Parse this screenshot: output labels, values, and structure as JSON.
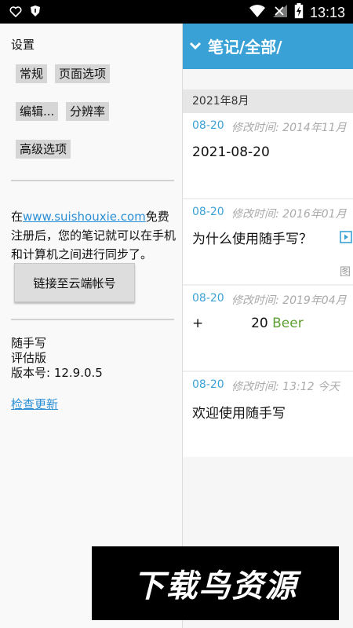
{
  "status_bar": {
    "time": "13:13"
  },
  "drawer": {
    "title": "设置",
    "chips": [
      "常规",
      "页面选项",
      "编辑...",
      "分辨率",
      "高级选项"
    ],
    "sync_prefix": "在",
    "sync_link": "www.suishouxie.com",
    "sync_suffix": "免费注册后，您的笔记就可以在手机和计算机之间进行同步了。",
    "cloud_button": "链接至云端帐号",
    "app_name": "随手写",
    "edition": "评估版",
    "version": "版本号: 12.9.0.5",
    "check_update": "检查更新"
  },
  "notes_panel": {
    "title": "笔记/全部/",
    "month": "2021年8月",
    "notes": [
      {
        "date": "08-20",
        "modified": "修改时间: 2014年11月",
        "body": "2021-08-20"
      },
      {
        "date": "08-20",
        "modified": "修改时间: 2016年01月",
        "body": "为什么使用随手写？",
        "extra": "图"
      },
      {
        "date": "08-20",
        "modified": "修改时间: 2019年04月",
        "body_plus": "+",
        "body_num": "20",
        "body_word": "Beer"
      },
      {
        "date": "08-20",
        "modified": "修改时间: 13:12 今天",
        "body": "欢迎使用随手写"
      }
    ]
  },
  "watermark": {
    "text": "下载鸟资源"
  },
  "colors": {
    "accent": "#3aa1d6",
    "link": "#2a8fd6",
    "beer": "#5fa033"
  }
}
